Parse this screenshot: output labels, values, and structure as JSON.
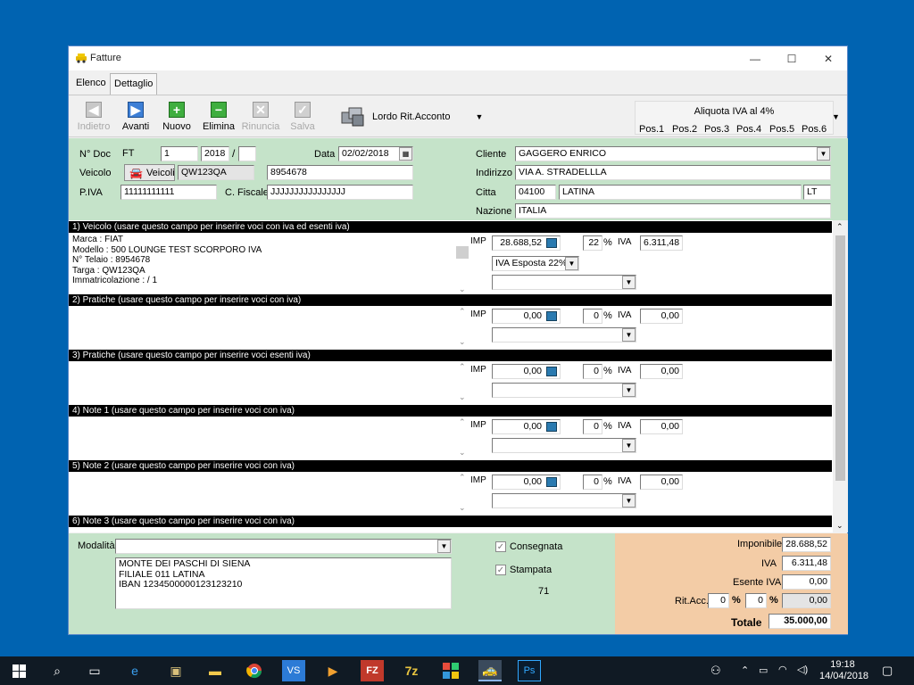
{
  "window": {
    "title": "Fatture",
    "minimize_icon": "minimize-icon",
    "maximize_icon": "maximize-icon",
    "close_icon": "close-icon"
  },
  "tabs": [
    {
      "label": "Elenco"
    },
    {
      "label": "Dettaglio"
    }
  ],
  "toolbar": {
    "indietro": "Indietro",
    "avanti": "Avanti",
    "nuovo": "Nuovo",
    "elimina": "Elimina",
    "rinuncia": "Rinuncia",
    "salva": "Salva",
    "lordo": "Lordo Rit.Acconto"
  },
  "aliquota": {
    "title": "Aliquota IVA al 4%",
    "positions": [
      "Pos.1",
      "Pos.2",
      "Pos.3",
      "Pos.4",
      "Pos.5",
      "Pos.6"
    ]
  },
  "doc": {
    "n_doc_label": "N° Doc",
    "prefix": "FT",
    "number": "1",
    "year": "2018",
    "slash": "/",
    "suffix": "",
    "data_label": "Data",
    "data": "02/02/2018",
    "veicolo_label": "Veicolo",
    "veicoli_button": "Veicoli",
    "targa": "QW123QA",
    "telaio": "8954678",
    "piva_label": "P.IVA",
    "piva": "11111111111",
    "cf_label": "C. Fiscale",
    "cf": "JJJJJJJJJJJJJJJJ"
  },
  "cliente": {
    "cliente_label": "Cliente",
    "cliente": "GAGGERO ENRICO",
    "indirizzo_label": "Indirizzo",
    "indirizzo": "VIA A. STRADELLLA",
    "citta_label": "Citta",
    "cap": "04100",
    "citta": "LATINA",
    "prov": "LT",
    "nazione_label": "Nazione",
    "nazione": "ITALIA"
  },
  "sections": [
    {
      "title": "1) Veicolo (usare questo campo per inserire voci con iva ed esenti iva)",
      "lines": [
        "Marca   : FIAT",
        "Modello : 500 LOUNGE TEST SCORPORO IVA",
        "N° Telaio : 8954678",
        "Targa : QW123QA",
        "Immatricolazione :  /    1"
      ],
      "imp_label": "IMP",
      "imp": "28.688,52",
      "perc": "22",
      "perc_sign": "%",
      "iva_label": "IVA",
      "iva": "6.311,48",
      "combo1": "IVA Esposta 22%",
      "combo2": ""
    },
    {
      "title": "2) Pratiche (usare questo campo per inserire voci con iva)",
      "lines": [],
      "imp_label": "IMP",
      "imp": "0,00",
      "perc": "0",
      "perc_sign": "%",
      "iva_label": "IVA",
      "iva": "0,00",
      "combo1": ""
    },
    {
      "title": "3) Pratiche (usare questo campo per inserire voci esenti iva)",
      "lines": [],
      "imp_label": "IMP",
      "imp": "0,00",
      "perc": "0",
      "perc_sign": "%",
      "iva_label": "IVA",
      "iva": "0,00",
      "combo1": ""
    },
    {
      "title": "4) Note 1 (usare questo campo per inserire voci con iva)",
      "lines": [],
      "imp_label": "IMP",
      "imp": "0,00",
      "perc": "0",
      "perc_sign": "%",
      "iva_label": "IVA",
      "iva": "0,00",
      "combo1": ""
    },
    {
      "title": "5) Note 2 (usare questo campo per inserire voci con iva)",
      "lines": [],
      "imp_label": "IMP",
      "imp": "0,00",
      "perc": "0",
      "perc_sign": "%",
      "iva_label": "IVA",
      "iva": "0,00",
      "combo1": ""
    },
    {
      "title": "6) Note 3 (usare questo campo per inserire voci con iva)"
    }
  ],
  "footer": {
    "modalita_label": "Modalità",
    "modalita": "",
    "bank_lines": [
      "MONTE DEI PASCHI DI SIENA",
      "FILIALE 011 LATINA",
      "IBAN 1234500000123123210"
    ],
    "consegnata": "Consegnata",
    "stampata": "Stampata",
    "count": "71"
  },
  "totals": {
    "imponibile_label": "Imponibile",
    "imponibile": "28.688,52",
    "iva_label": "IVA",
    "iva": "6.311,48",
    "esente_label": "Esente IVA",
    "esente": "0,00",
    "ritacc_label": "Rit.Acc.",
    "rit1": "0",
    "rit2": "0",
    "perc_sign": "%",
    "ritval": "0,00",
    "totale_label": "Totale",
    "totale": "35.000,00"
  },
  "taskbar": {
    "time": "19:18",
    "date": "14/04/2018"
  },
  "colors": {
    "desktop": "#0063b1",
    "green_panel": "#c5e3c9",
    "orange_panel": "#f3cca6",
    "taskbar": "#101a24"
  }
}
